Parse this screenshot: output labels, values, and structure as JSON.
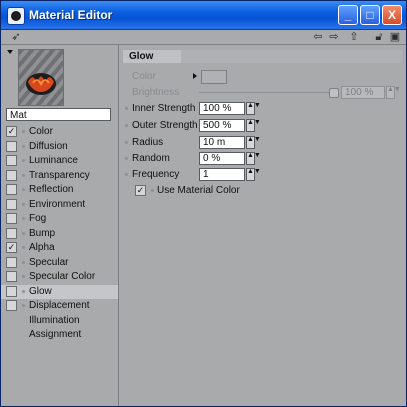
{
  "window": {
    "title": "Material Editor"
  },
  "titlebar_buttons": {
    "minimize": "_",
    "maximize": "□",
    "close": "X"
  },
  "toolbar": {
    "icons": [
      "cursor-arrow-icon",
      "back-arrow-icon",
      "forward-arrow-icon",
      "up-arrow-icon",
      "lock-icon",
      "new-window-icon"
    ]
  },
  "material": {
    "name": "Mat"
  },
  "channels": [
    {
      "label": "Color",
      "checked": true
    },
    {
      "label": "Diffusion",
      "checked": false
    },
    {
      "label": "Luminance",
      "checked": false
    },
    {
      "label": "Transparency",
      "checked": false
    },
    {
      "label": "Reflection",
      "checked": false
    },
    {
      "label": "Environment",
      "checked": false
    },
    {
      "label": "Fog",
      "checked": false
    },
    {
      "label": "Bump",
      "checked": false
    },
    {
      "label": "Alpha",
      "checked": true
    },
    {
      "label": "Specular",
      "checked": false
    },
    {
      "label": "Specular Color",
      "checked": false
    },
    {
      "label": "Glow",
      "checked": false,
      "selected": true
    },
    {
      "label": "Displacement",
      "checked": false
    }
  ],
  "extra_items": [
    "Illumination",
    "Assignment"
  ],
  "glow": {
    "group_title": "Glow",
    "color_label": "Color",
    "brightness_label": "Brightness",
    "brightness_value": "100 %",
    "inner_strength_label": "Inner Strength",
    "inner_strength_value": "100 %",
    "outer_strength_label": "Outer Strength",
    "outer_strength_value": "500 %",
    "radius_label": "Radius",
    "radius_value": "10 m",
    "random_label": "Random",
    "random_value": "0 %",
    "frequency_label": "Frequency",
    "frequency_value": "1",
    "use_material_color_label": "Use Material Color",
    "use_material_color_checked": true
  },
  "checkmark": "✓",
  "spinner_glyph": "▲▼"
}
